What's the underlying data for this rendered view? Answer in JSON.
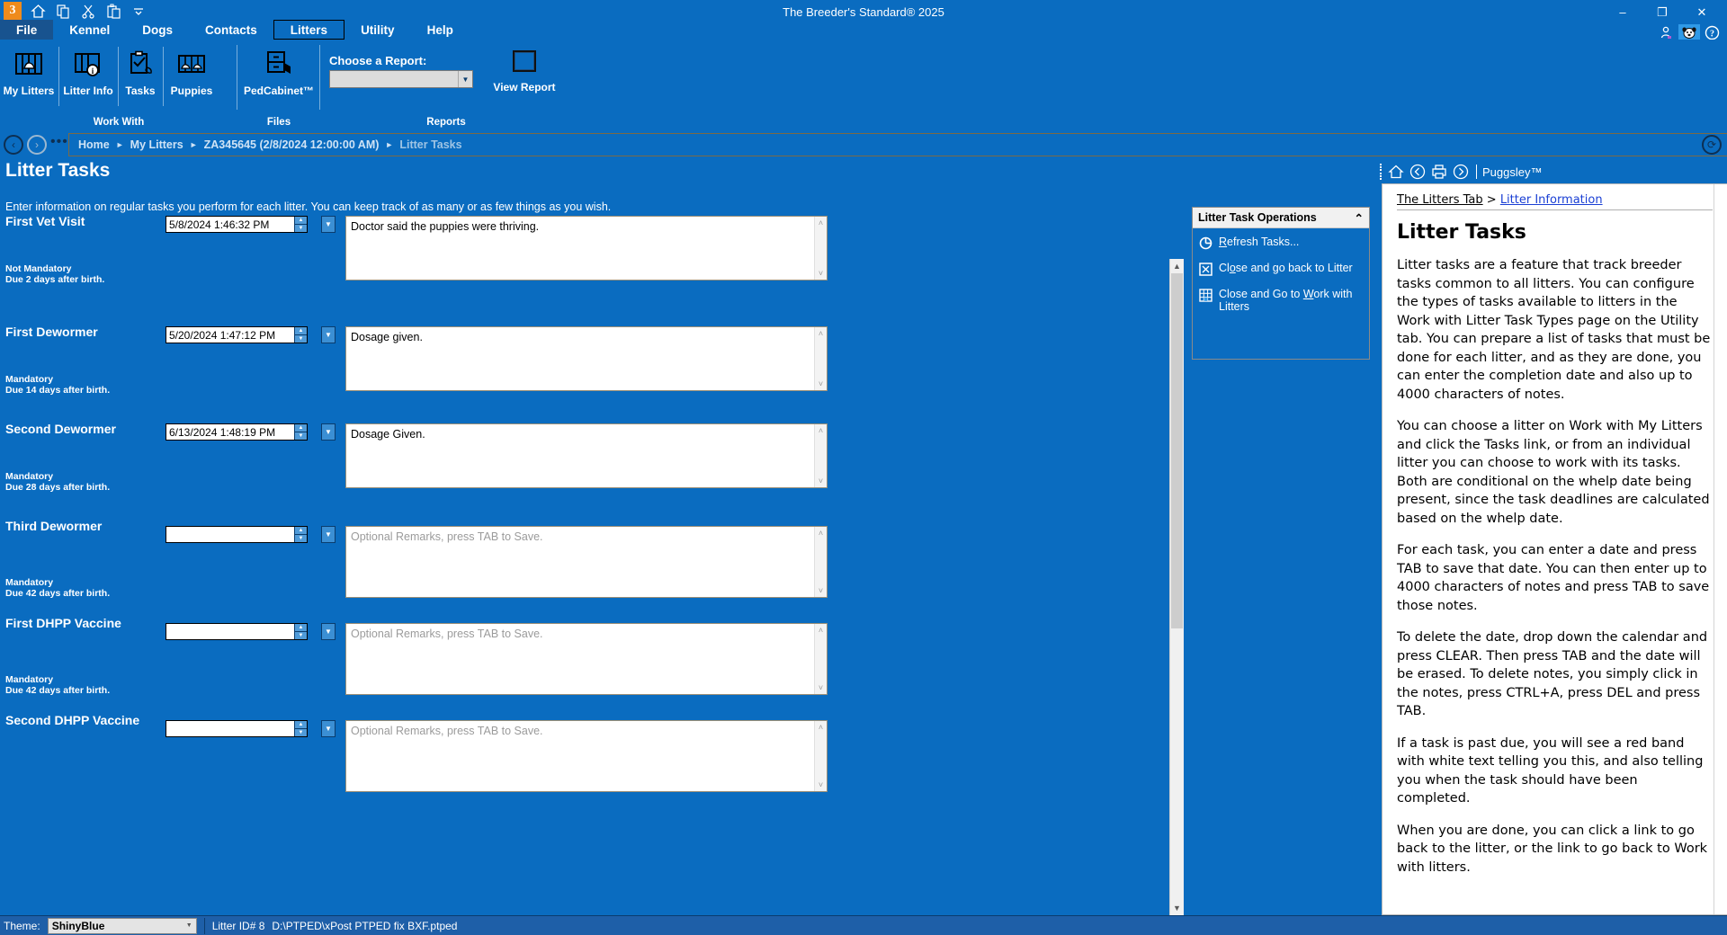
{
  "window": {
    "title": "The Breeder's Standard® 2025",
    "minimize": "–",
    "maximize": "❐",
    "close": "✕",
    "logo_text": "3"
  },
  "quick_access": [
    {
      "name": "home-icon",
      "glyph": "home"
    },
    {
      "name": "copy-icon",
      "glyph": "copy"
    },
    {
      "name": "cut-icon",
      "glyph": "cut"
    },
    {
      "name": "paste-icon",
      "glyph": "paste"
    },
    {
      "name": "customize-icon",
      "glyph": "chevron"
    }
  ],
  "menu_tabs": [
    {
      "label": "File",
      "active": false,
      "file": true
    },
    {
      "label": "Kennel",
      "active": false
    },
    {
      "label": "Dogs",
      "active": false
    },
    {
      "label": "Contacts",
      "active": false
    },
    {
      "label": "Litters",
      "active": true
    },
    {
      "label": "Utility",
      "active": false
    },
    {
      "label": "Help",
      "active": false
    }
  ],
  "ribbon": {
    "groups": [
      {
        "label": "Work With"
      },
      {
        "label": "Files"
      },
      {
        "label": "Reports"
      }
    ],
    "work_with": [
      {
        "label": "My Litters",
        "icon": "crib-dog-icon"
      },
      {
        "label": "Litter Info",
        "icon": "crib-info-icon"
      },
      {
        "label": "Tasks",
        "icon": "clipboard-check-icon"
      },
      {
        "label": "Puppies",
        "icon": "crib-puppies-icon"
      }
    ],
    "files": [
      {
        "label": "PedCabinet™",
        "icon": "file-cabinet-icon"
      }
    ],
    "reports": {
      "choose_label": "Choose a Report:",
      "combo_value": "",
      "view_report_label": "View Report"
    }
  },
  "breadcrumb": {
    "items": [
      "Home",
      "My Litters",
      "ZA345645 (2/8/2024 12:00:00 AM)",
      "Litter Tasks"
    ],
    "separator": "►"
  },
  "page": {
    "title": "Litter Tasks",
    "subtitle": "Enter information on regular tasks you perform for each litter. You can keep track of as many or as few things as you wish."
  },
  "notes_placeholder": "Optional Remarks, press TAB to Save.",
  "tasks": [
    {
      "label": "First Vet Visit",
      "date": "5/8/2024 1:46:32 PM",
      "notes": "Doctor said the puppies were thriving.",
      "mandatory": "Not Mandatory",
      "due": "Due 2 days after birth.",
      "notes_is_placeholder": false
    },
    {
      "label": "First Dewormer",
      "date": "5/20/2024 1:47:12 PM",
      "notes": "Dosage given.",
      "mandatory": "Mandatory",
      "due": "Due 14 days after birth.",
      "notes_is_placeholder": false
    },
    {
      "label": "Second Dewormer",
      "date": "6/13/2024 1:48:19 PM",
      "notes": "Dosage Given.",
      "mandatory": "Mandatory",
      "due": "Due 28 days after birth.",
      "notes_is_placeholder": false
    },
    {
      "label": "Third Dewormer",
      "date": "",
      "notes": "Optional Remarks, press TAB to Save.",
      "mandatory": "Mandatory",
      "due": "Due 42 days after birth.",
      "notes_is_placeholder": true
    },
    {
      "label": "First DHPP Vaccine",
      "date": "",
      "notes": "Optional Remarks, press TAB to Save.",
      "mandatory": "Mandatory",
      "due": "Due 42 days after birth.",
      "notes_is_placeholder": true
    },
    {
      "label": "Second DHPP Vaccine",
      "date": "",
      "notes": "Optional Remarks, press TAB to Save.",
      "mandatory": "",
      "due": "",
      "notes_is_placeholder": true
    }
  ],
  "operations": {
    "title": "Litter Task Operations",
    "collapse_glyph": "⌃",
    "items": [
      {
        "label_pre": "",
        "underline": "R",
        "label_post": "efresh Tasks...",
        "icon": "refresh-icon"
      },
      {
        "label_pre": "Cl",
        "underline": "o",
        "label_post": "se and go back to Litter",
        "icon": "close-box-icon"
      },
      {
        "label_pre": "Close and Go to ",
        "underline": "W",
        "label_post": "ork with Litters",
        "icon": "grid-litters-icon"
      }
    ]
  },
  "help": {
    "toolbar": {
      "home": "home-icon",
      "back": "back-icon",
      "print": "print-icon",
      "forward": "forward-icon",
      "brand": "Puggsley™"
    },
    "breadcrumb_a": "The Litters Tab",
    "breadcrumb_sep": ">",
    "breadcrumb_b": "Litter Information",
    "heading": "Litter Tasks",
    "paragraphs": [
      "Litter tasks are a feature that track breeder tasks common to all litters.  You can configure the types of tasks available to litters in the Work with Litter Task Types page on the Utility tab. You can prepare a list of tasks that must be done for each litter, and as they are done, you can enter the completion date and also up to 4000 characters of notes.",
      "You can choose a litter on Work with My Litters and click the Tasks link, or from an individual litter you can choose to work with its tasks.  Both are conditional on the whelp date being present, since the task deadlines are calculated based on the whelp date.",
      "For each task, you can enter a date and press TAB to save that date. You can then enter up to 4000 characters of notes and press TAB to save those notes.",
      "To delete the date, drop down the calendar and press CLEAR.  Then press TAB and the date will be erased.  To delete notes, you simply click in the notes, press CTRL+A, press DEL and press TAB.",
      "If a task is past due, you will see a red band with white text telling you this, and also telling you when the task should have been completed.",
      "When you are done, you can click a link to go back to the litter, or the link to go back to Work with litters."
    ]
  },
  "statusbar": {
    "theme_label": "Theme:",
    "theme_value": "ShinyBlue",
    "litter_id": "Litter ID# 8",
    "file_path": "D:\\PTPED\\xPost PTPED fix BXF.ptped"
  },
  "colors": {
    "window_blue": "#0a6cc0",
    "file_tab": "#18538f",
    "status_blue": "#1e5fa8",
    "panel_header": "#f1f1f1",
    "link_blue": "#1a3fd4"
  }
}
